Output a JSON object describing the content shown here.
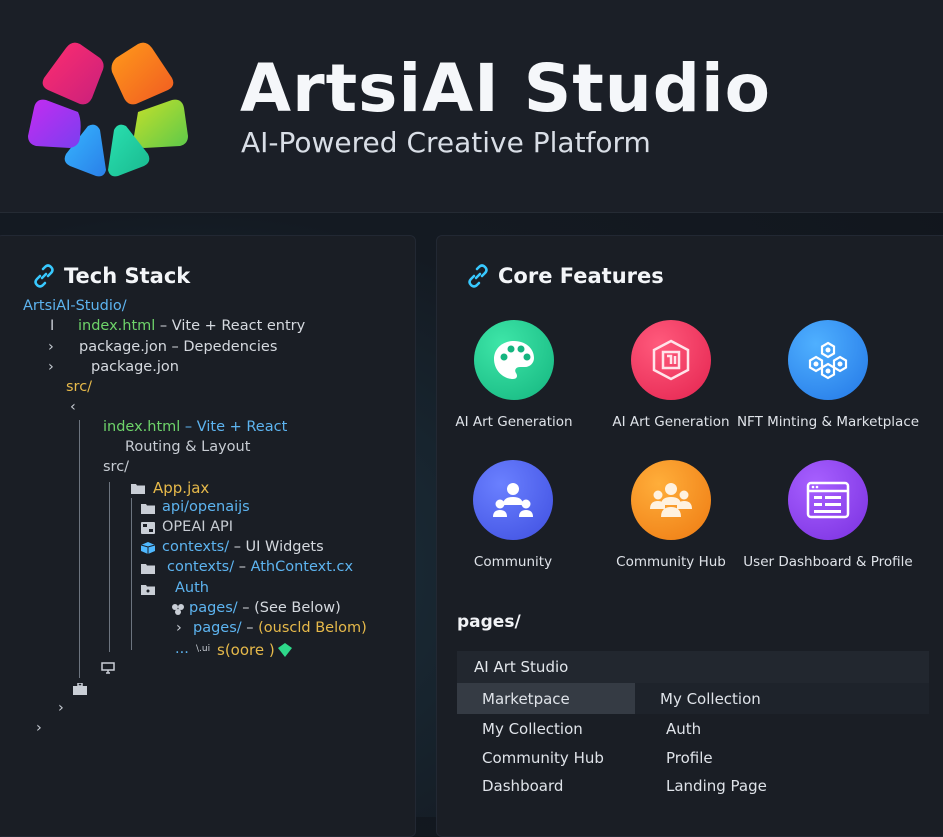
{
  "header": {
    "title": "ArtsiAI Studio",
    "subtitle": "AI-Powered Creative Platform",
    "logo_colors": [
      "#f0327a",
      "#f08a1e",
      "#9ccf2a",
      "#2ad6a8",
      "#2e9cf0",
      "#9b3ef0"
    ]
  },
  "tech_stack": {
    "title": "Tech Stack",
    "icon": "link-icon",
    "tree": {
      "root": "ArtsiAI-Studio/",
      "l1_marker": "I",
      "l1_file": "index.html",
      "l1_desc": " – Vite + React entry",
      "l2_name": "package.jon",
      "l2_desc": " – Depedencies",
      "l3_name": "package.jon",
      "src1": "src/",
      "idx_file": "index.html",
      "idx_desc": " – Vite + React",
      "routing": "Routing & Layout",
      "src2": "src/",
      "appjax": "App.jax",
      "api": "api/openaijs",
      "openai": "OPEAI API",
      "contexts1_name": "contexts/",
      "contexts1_desc": " – UI Widgets",
      "contexts2_name": "contexts/",
      "contexts2_sep": " – ",
      "contexts2_file": "AthContext.cx",
      "auth": "Auth",
      "pages1_name": "pages/",
      "pages1_desc": " – (See Below)",
      "pages2_name": "pages/",
      "pages2_sep": " – ",
      "pages2_desc": "(ouscld Belom)",
      "core_dots": "...",
      "core_small": "\\.ui",
      "core_name": "s(oore )"
    }
  },
  "core_features": {
    "title": "Core Features",
    "icon": "link-icon",
    "items": [
      {
        "label": "AI Art Generation",
        "icon": "palette-icon",
        "color": "#1fc990"
      },
      {
        "label": "AI Art Generation",
        "icon": "ai-chip-icon",
        "color": "#f0335d"
      },
      {
        "label": "NFT Minting & Marketplace",
        "icon": "hexagon-network-icon",
        "color": "#2e8ef0"
      },
      {
        "label": "Community",
        "icon": "users-group-icon",
        "color": "#4a62e8"
      },
      {
        "label": "Community Hub",
        "icon": "people-hub-icon",
        "color": "#f0891c"
      },
      {
        "label": "User Dashboard & Profile",
        "icon": "dashboard-window-icon",
        "color": "#8a3ee6"
      }
    ]
  },
  "pages": {
    "title": "pages/",
    "header": "AI Art Studio",
    "left_col": [
      "Marketpace",
      "My Collection",
      "Community Hub",
      "Dashboard"
    ],
    "right_col": [
      "My Collection",
      "Auth",
      "Profile",
      "Landing Page"
    ]
  }
}
